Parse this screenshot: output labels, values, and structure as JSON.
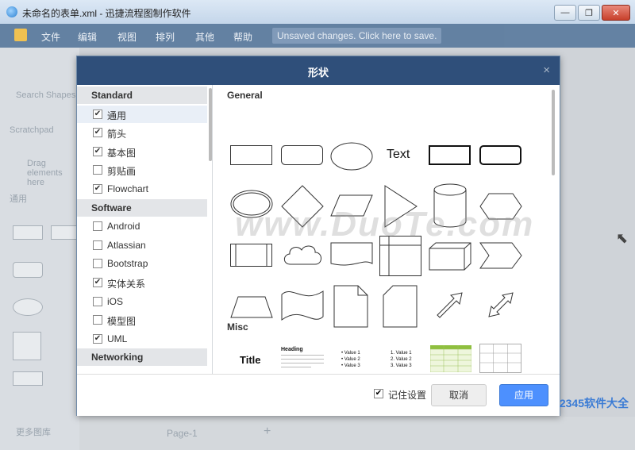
{
  "window": {
    "title": "未命名的表单.xml - 迅捷流程图制作软件",
    "buttons": [
      "—",
      "❐",
      "✕"
    ]
  },
  "menubar": {
    "items": [
      "文件",
      "编辑",
      "视图",
      "排列",
      "其他",
      "帮助"
    ],
    "unsaved_notice": "Unsaved changes. Click here to save."
  },
  "background": {
    "search_placeholder": "Search Shapes",
    "scratchpad": "Scratchpad",
    "drag_hint": "Drag elements here",
    "general": "通用",
    "more_shapes": "更多图库",
    "page_tab": "Page-1"
  },
  "dialog": {
    "title": "形状",
    "close": "×",
    "categories": [
      {
        "type": "head",
        "label": "Standard"
      },
      {
        "type": "item",
        "label": "通用",
        "checked": true,
        "selected": true
      },
      {
        "type": "item",
        "label": "箭头",
        "checked": true
      },
      {
        "type": "item",
        "label": "基本图",
        "checked": true
      },
      {
        "type": "item",
        "label": "剪贴画",
        "checked": false
      },
      {
        "type": "item",
        "label": "Flowchart",
        "checked": true
      },
      {
        "type": "head",
        "label": "Software"
      },
      {
        "type": "item",
        "label": "Android",
        "checked": false
      },
      {
        "type": "item",
        "label": "Atlassian",
        "checked": false
      },
      {
        "type": "item",
        "label": "Bootstrap",
        "checked": false
      },
      {
        "type": "item",
        "label": "实体关系",
        "checked": true
      },
      {
        "type": "item",
        "label": "iOS",
        "checked": false
      },
      {
        "type": "item",
        "label": "模型图",
        "checked": false
      },
      {
        "type": "item",
        "label": "UML",
        "checked": true
      },
      {
        "type": "head",
        "label": "Networking"
      }
    ],
    "sections": {
      "general": "General",
      "misc": "Misc"
    },
    "shape_text": "Text",
    "misc_previews": {
      "title": "Title",
      "heading": "Heading",
      "bullets": [
        "• Value 1",
        "• Value 2",
        "• Value 3"
      ],
      "numbered": [
        "1. Value 1",
        "2. Value 2",
        "3. Value 3"
      ]
    },
    "footer": {
      "remember": "记住设置",
      "remember_checked": true,
      "cancel": "取消",
      "apply": "应用"
    }
  },
  "watermark": {
    "text": "www.DuoTe.com",
    "brand": "2345软件大全"
  }
}
